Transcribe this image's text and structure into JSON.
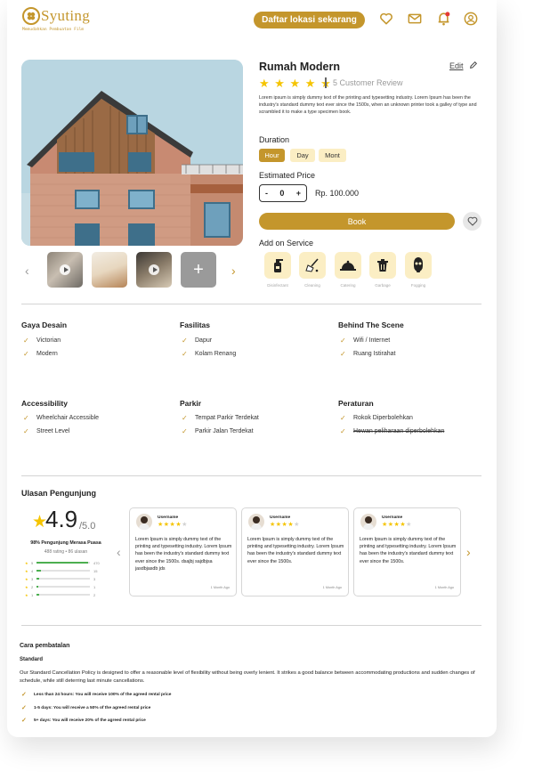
{
  "header": {
    "brand": "Syuting",
    "tagline": "Memudahkan Pembuatan Film",
    "cta_label": "Daftar lokasi sekarang",
    "icons": [
      "heart-icon",
      "mail-icon",
      "bell-icon",
      "user-icon"
    ],
    "accent_color": "#c4962c"
  },
  "gallery": {
    "prev": "‹",
    "next": "›",
    "add": "+"
  },
  "listing": {
    "title": "Rumah Modern",
    "edit_label": "Edit",
    "rating_stars": 5,
    "stars_text": "★ ★ ★ ★ ★",
    "review_label": "5 Customer Review",
    "description": "Lorem ipsum is simply dummy text of the printing and typesetting industry. Lorem Ipsum has been the industry's standard dummy text ever since the 1500s, when an unknown printer took a galley of type and scrambled it to make a type specimen book.",
    "duration_label": "Duration",
    "duration_options": [
      "Hour",
      "Day",
      "Mont"
    ],
    "duration_selected": "Hour",
    "estimated_price_label": "Estimated Price",
    "quantity": "0",
    "minus": "-",
    "plus": "+",
    "price": "Rp. 100.000",
    "book_label": "Book",
    "add_on_label": "Add on Service",
    "services": [
      {
        "label": "Disinfectant",
        "icon": "spray-bottle-icon"
      },
      {
        "label": "Cleaning",
        "icon": "broom-icon"
      },
      {
        "label": "Catering",
        "icon": "cloche-icon"
      },
      {
        "label": "Garbage",
        "icon": "trash-icon"
      },
      {
        "label": "Fogging",
        "icon": "gas-mask-icon"
      }
    ]
  },
  "features": {
    "gaya_desain": {
      "title": "Gaya Desain",
      "items": [
        "Victorian",
        "Modern"
      ]
    },
    "fasilitas": {
      "title": "Fasilitas",
      "items": [
        "Dapur",
        "Kolam Renang"
      ]
    },
    "behind": {
      "title": "Behind The Scene",
      "items": [
        "Wifi / Internet",
        "Ruang Istirahat"
      ]
    },
    "accessibility": {
      "title": "Accessibility",
      "items": [
        "Wheelchair Accessible",
        "Street Level"
      ]
    },
    "parkir": {
      "title": "Parkir",
      "items": [
        "Tempat Parkir Terdekat",
        "Parkir Jalan Terdekat"
      ]
    },
    "peraturan": {
      "title": "Peraturan",
      "items": [
        "Rokok Diperbolehkan",
        "Hewan peliharaan diperbolehkan"
      ],
      "struck": [
        false,
        true
      ]
    }
  },
  "reviews": {
    "title": "Ulasan Pengunjung",
    "score": "4.9",
    "out_of": "/5.0",
    "percent_text": "98% Pengunjung Merasa Puasa",
    "counts_text": "488 rating • 86 ulasan",
    "breakdown": [
      {
        "star": "5",
        "count": "470",
        "fraction": 0.96
      },
      {
        "star": "4",
        "count": "15",
        "fraction": 0.08
      },
      {
        "star": "3",
        "count": "3",
        "fraction": 0.05
      },
      {
        "star": "2",
        "count": "1",
        "fraction": 0.04
      },
      {
        "star": "1",
        "count": "2",
        "fraction": 0.05
      }
    ],
    "prev": "‹",
    "next": "›",
    "cards": [
      {
        "user": "Username",
        "stars": 4,
        "text": "Lorem Ipsum is simply dummy text of the printing and typesetting industry. Lorem Ipsum has been the industry's standard dummy text ever since the 1500s. dsajbj sajdbjsa jasdbjasdb jds",
        "date": "1 Month Ago"
      },
      {
        "user": "Username",
        "stars": 4,
        "text": "Lorem Ipsum is simply dummy text of the printing and typesetting industry. Lorem Ipsum has been the industry's standard dummy text ever since the 1500s.",
        "date": "1 Month Ago"
      },
      {
        "user": "Username",
        "stars": 4,
        "text": "Lorem Ipsum is simply dummy text of the printing and typesetting industry. Lorem Ipsum has been the industry's standard dummy text ever since the 1500s.",
        "date": "1 Month Ago"
      }
    ]
  },
  "cancellation": {
    "title": "Cara pembatalan",
    "policy_name": "Standard",
    "description": "Our Standard Cancellation Policy is designed to offer a reasonable level of flexibility without being overly lenient. It strikes a good balance between accommodating productions and sudden changes of schedule, while still deterring last minute cancellations.",
    "items": [
      "Less than 24 hours: You will receive 100% of the agreed rental price",
      "1-5 days: You will receive a 50% of the agreed rental price",
      "5+ days: You will receive 20% of the agreed rental price"
    ]
  }
}
